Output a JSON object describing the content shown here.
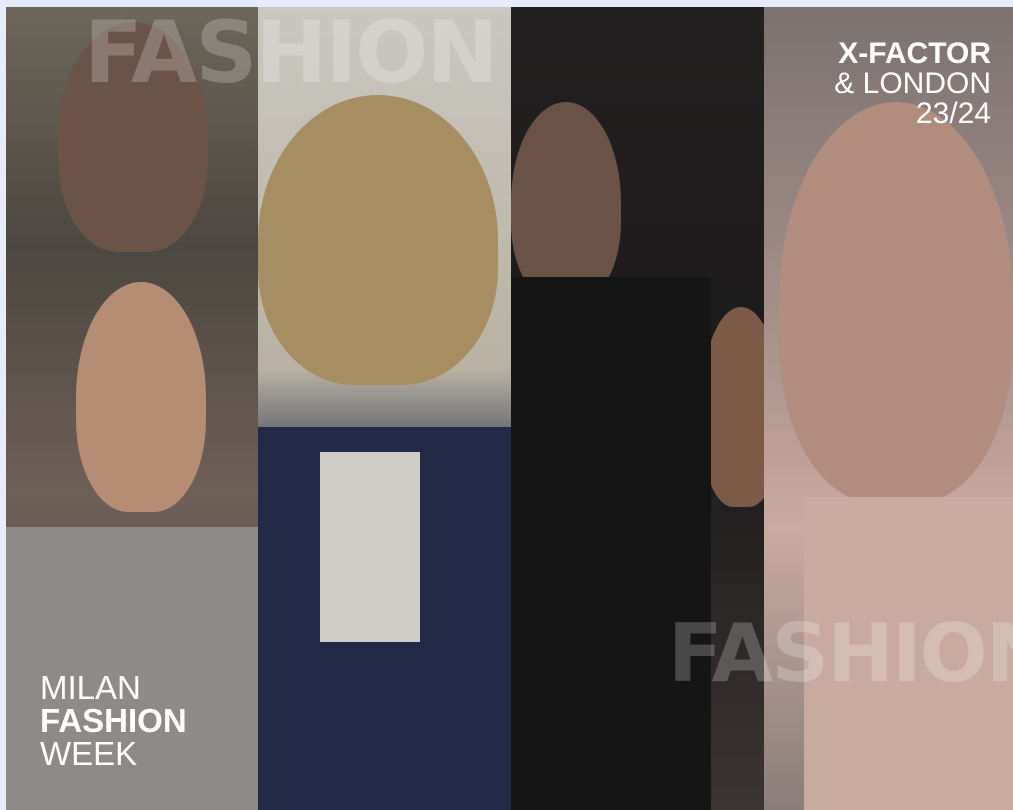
{
  "header": {
    "brand_line": "X-FACTOR",
    "city_line": "& LONDON",
    "season_line": "23/24"
  },
  "title": {
    "line1": "MILAN",
    "line2": "FASHION",
    "line3": "WEEK"
  },
  "background_text": {
    "word": "FASHION"
  },
  "colors": {
    "page_background": "#e6ecfb",
    "text": "#ffffff"
  }
}
